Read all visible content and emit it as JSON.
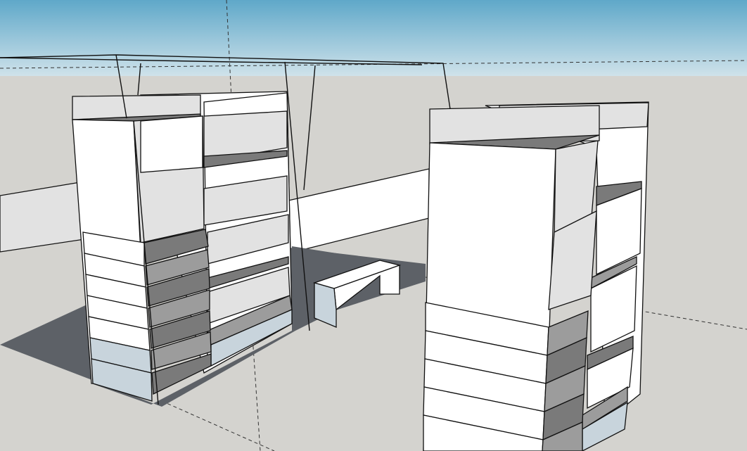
{
  "scene": {
    "sky_top": "#5fa8c9",
    "sky_bottom": "#cfe2ea",
    "ground": "#d4d3cf",
    "shadow": "#5d6167",
    "edge_color": "#111111",
    "objects": [
      "shelving-unit-left",
      "shelving-unit-right",
      "low-bench",
      "roof-frame"
    ]
  }
}
